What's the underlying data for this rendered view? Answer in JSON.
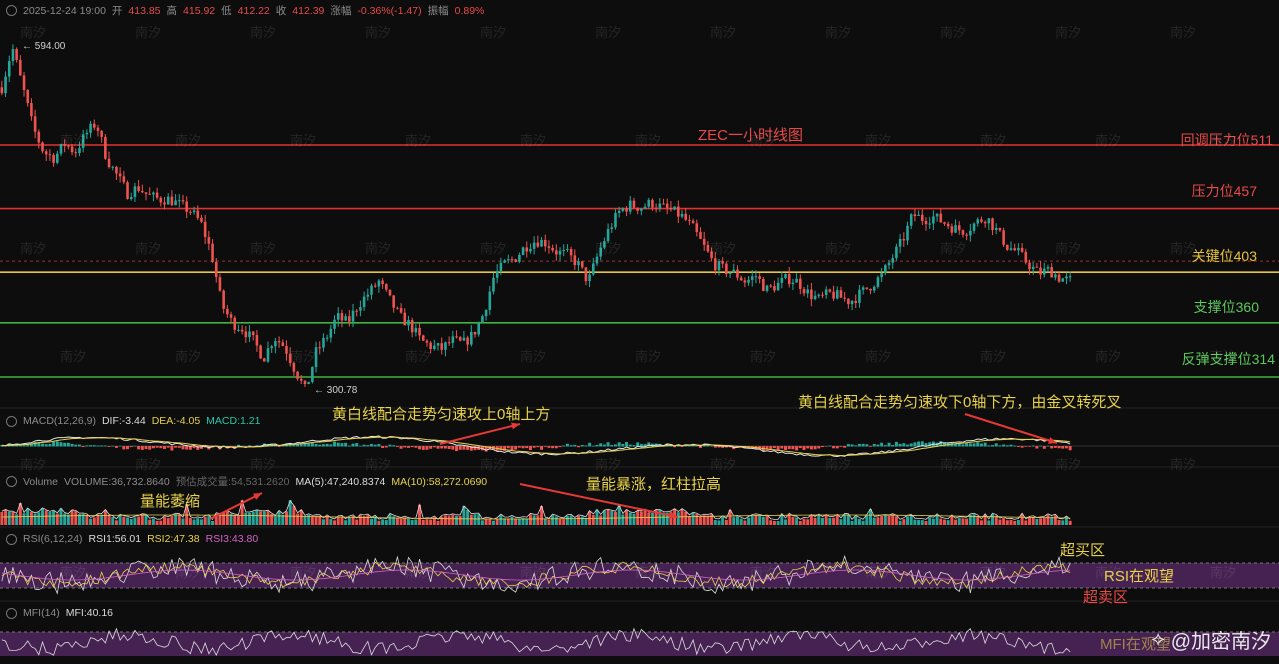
{
  "header": {
    "datetime": "2025-12-24 19:00",
    "open_label": "开",
    "open": "413.85",
    "high_label": "高",
    "high": "415.92",
    "low_label": "低",
    "low": "412.22",
    "close_label": "收",
    "close": "412.39",
    "change_label": "涨幅",
    "change": "-0.36%(-1.47)",
    "amplitude_label": "振幅",
    "amplitude": "0.89%"
  },
  "chart_data": {
    "type": "line",
    "title": "ZEC一小时线图",
    "price_extremes": {
      "high_marker": "594.00",
      "low_marker": "300.78"
    },
    "levels": [
      {
        "label": "回调压力位511",
        "value": 511,
        "color": "#e03131"
      },
      {
        "label": "压力位457",
        "value": 457,
        "color": "#e03131"
      },
      {
        "label": "关键位403",
        "value": 403,
        "color": "#e8c43a"
      },
      {
        "label": "支撑位360",
        "value": 360,
        "color": "#3fb53f"
      },
      {
        "label": "反弹支撑位314",
        "value": 314,
        "color": "#3fb53f"
      }
    ],
    "price_path": [
      [
        0,
        560
      ],
      [
        1,
        594
      ],
      [
        2,
        560
      ],
      [
        3,
        525
      ],
      [
        4,
        505
      ],
      [
        5,
        500
      ],
      [
        6,
        512
      ],
      [
        7,
        505
      ],
      [
        8,
        520
      ],
      [
        9,
        530
      ],
      [
        10,
        500
      ],
      [
        11,
        485
      ],
      [
        12,
        470
      ],
      [
        13,
        475
      ],
      [
        14,
        468
      ],
      [
        15,
        465
      ],
      [
        16,
        465
      ],
      [
        17,
        460
      ],
      [
        18,
        455
      ],
      [
        19,
        445
      ],
      [
        20,
        420
      ],
      [
        21,
        375
      ],
      [
        22,
        360
      ],
      [
        23,
        355
      ],
      [
        24,
        345
      ],
      [
        25,
        330
      ],
      [
        26,
        348
      ],
      [
        27,
        340
      ],
      [
        28,
        320
      ],
      [
        29,
        302
      ],
      [
        30,
        335
      ],
      [
        31,
        348
      ],
      [
        32,
        365
      ],
      [
        33,
        360
      ],
      [
        34,
        375
      ],
      [
        35,
        385
      ],
      [
        36,
        395
      ],
      [
        37,
        380
      ],
      [
        38,
        365
      ],
      [
        39,
        358
      ],
      [
        40,
        345
      ],
      [
        41,
        340
      ],
      [
        42,
        338
      ],
      [
        43,
        345
      ],
      [
        44,
        342
      ],
      [
        45,
        350
      ],
      [
        46,
        368
      ],
      [
        47,
        400
      ],
      [
        48,
        410
      ],
      [
        49,
        415
      ],
      [
        50,
        425
      ],
      [
        51,
        430
      ],
      [
        52,
        428
      ],
      [
        53,
        420
      ],
      [
        54,
        418
      ],
      [
        55,
        410
      ],
      [
        56,
        395
      ],
      [
        57,
        420
      ],
      [
        58,
        440
      ],
      [
        59,
        455
      ],
      [
        60,
        460
      ],
      [
        61,
        458
      ],
      [
        62,
        462
      ],
      [
        63,
        458
      ],
      [
        64,
        455
      ],
      [
        65,
        450
      ],
      [
        66,
        440
      ],
      [
        67,
        425
      ],
      [
        68,
        410
      ],
      [
        69,
        405
      ],
      [
        70,
        402
      ],
      [
        71,
        395
      ],
      [
        72,
        400
      ],
      [
        73,
        388
      ],
      [
        74,
        392
      ],
      [
        75,
        398
      ],
      [
        76,
        395
      ],
      [
        77,
        385
      ],
      [
        78,
        380
      ],
      [
        79,
        385
      ],
      [
        80,
        382
      ],
      [
        81,
        378
      ],
      [
        82,
        385
      ],
      [
        83,
        392
      ],
      [
        84,
        400
      ],
      [
        85,
        415
      ],
      [
        86,
        430
      ],
      [
        87,
        452
      ],
      [
        88,
        448
      ],
      [
        89,
        450
      ],
      [
        90,
        445
      ],
      [
        91,
        440
      ],
      [
        92,
        438
      ],
      [
        93,
        445
      ],
      [
        94,
        450
      ],
      [
        95,
        438
      ],
      [
        96,
        425
      ],
      [
        97,
        420
      ],
      [
        98,
        410
      ],
      [
        99,
        402
      ],
      [
        100,
        405
      ],
      [
        101,
        398
      ],
      [
        102,
        396
      ]
    ],
    "macd": {
      "label": "MACD(12,26,9)",
      "dif": "DIF:-3.44",
      "dea": "DEA:-4.05",
      "macd": "MACD:1.21"
    },
    "volume": {
      "label": "Volume",
      "volume": "VOLUME:36,732.8640",
      "estimate": "预估成交量:54,531.2620",
      "ma5": "MA(5):47,240.8374",
      "ma10": "MA(10):58,272.0690"
    },
    "rsi": {
      "label": "RSI(6,12,24)",
      "rsi1": "RSI1:56.01",
      "rsi2": "RSI2:47.38",
      "rsi3": "RSI3:43.80"
    },
    "mfi": {
      "label": "MFI(14)",
      "mfi": "MFI:40.16"
    },
    "annotations": {
      "macd_up": "黄白线配合走势匀速攻上0轴上方",
      "macd_down": "黄白线配合走势匀速攻下0轴下方，由金叉转死叉",
      "vol_shrink": "量能萎缩",
      "vol_surge": "量能暴涨，红柱拉高",
      "overbought": "超买区",
      "rsi_watch": "RSI在观望",
      "oversold": "超卖区",
      "mfi_watch": "MFI在观望"
    }
  },
  "watermark": "南汐",
  "brand": {
    "name": "@加密南汐"
  },
  "colors": {
    "up": "#26a69a",
    "down": "#ef5350",
    "dif": "#e6e6e6",
    "dea": "#e8d24a",
    "rsi_band": "#5a2a6a"
  }
}
